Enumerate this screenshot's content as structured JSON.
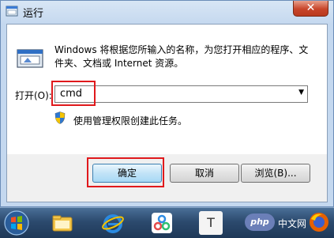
{
  "window": {
    "title": "运行",
    "close_glyph": "✕"
  },
  "dialog": {
    "description": "Windows 将根据您所输入的名称，为您打开相应的程序、文件夹、文档或 Internet 资源。",
    "open_label": "打开(O):",
    "command_value": "cmd",
    "admin_note": "使用管理权限创建此任务。"
  },
  "buttons": {
    "ok": "确定",
    "cancel": "取消",
    "browse": "浏览(B)..."
  },
  "taskbar": {
    "php_badge": "php",
    "site_text": "中文网",
    "app4_letter": "T"
  },
  "colors": {
    "highlight_red": "#e0191c",
    "titlebar": "#c4d8ef",
    "close_button": "#c8452a"
  }
}
